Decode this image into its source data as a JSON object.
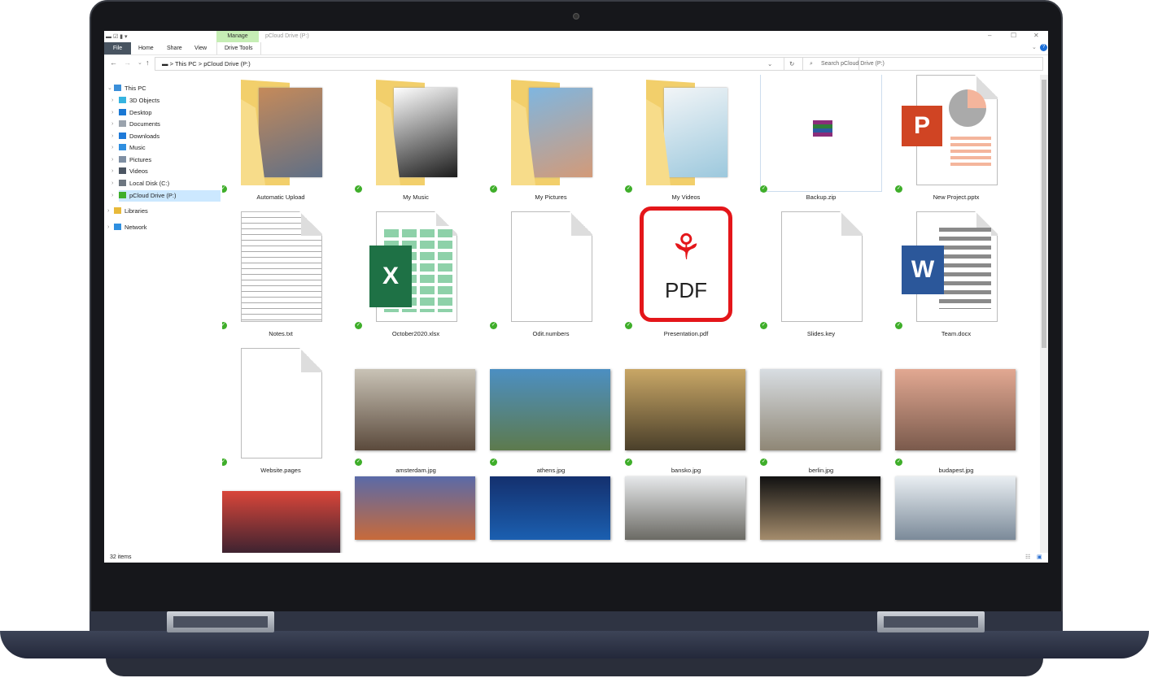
{
  "window": {
    "title": "pCloud Drive (P:)",
    "manage_tab": "Manage",
    "tabs": [
      "File",
      "Home",
      "Share",
      "View",
      "Drive Tools"
    ],
    "controls": {
      "minimize": "–",
      "maximize": "☐",
      "close": "✕"
    }
  },
  "address": {
    "parts": [
      "This PC",
      "pCloud Drive (P:)"
    ],
    "sep": ">",
    "search_placeholder": "Search pCloud Drive (P:)"
  },
  "nav": {
    "items": [
      {
        "label": "This PC",
        "indent": 0,
        "color": "#3b8fd9",
        "open": true
      },
      {
        "label": "3D Objects",
        "indent": 1,
        "color": "#36b4e0"
      },
      {
        "label": "Desktop",
        "indent": 1,
        "color": "#1a78d4"
      },
      {
        "label": "Documents",
        "indent": 1,
        "color": "#9aa3ad"
      },
      {
        "label": "Downloads",
        "indent": 1,
        "color": "#1f7ad8"
      },
      {
        "label": "Music",
        "indent": 1,
        "color": "#2f8fe0"
      },
      {
        "label": "Pictures",
        "indent": 1,
        "color": "#7f8fa3"
      },
      {
        "label": "Videos",
        "indent": 1,
        "color": "#4c5663"
      },
      {
        "label": "Local Disk (C:)",
        "indent": 1,
        "color": "#6d7680"
      },
      {
        "label": "pCloud Drive (P:)",
        "indent": 1,
        "color": "#3fae2a",
        "selected": true
      },
      {
        "label": "Libraries",
        "indent": 0,
        "color": "#e8b93a"
      },
      {
        "label": "Network",
        "indent": 0,
        "color": "#2e8fe0"
      }
    ]
  },
  "files": [
    {
      "name": "Automatic Upload",
      "kind": "folder",
      "colors": [
        "#c58a5a",
        "#5f6f86"
      ]
    },
    {
      "name": "My Music",
      "kind": "folder",
      "colors": [
        "#ffffff",
        "#1c1c1c"
      ]
    },
    {
      "name": "My Pictures",
      "kind": "folder",
      "colors": [
        "#7fb6e0",
        "#d39a78"
      ]
    },
    {
      "name": "My Videos",
      "kind": "folder",
      "colors": [
        "#f2f5f7",
        "#9cc8dd"
      ]
    },
    {
      "name": "Backup.zip",
      "kind": "zip",
      "colors": [
        "#8b2d7a",
        "#2f7d3a"
      ]
    },
    {
      "name": "New Project.pptx",
      "kind": "pptx",
      "colors": [
        "#d04423",
        "#f4b59c"
      ]
    },
    {
      "name": "Notes.txt",
      "kind": "txt",
      "colors": [
        "#ffffff",
        "#c8c8c8"
      ]
    },
    {
      "name": "October2020.xlsx",
      "kind": "xlsx",
      "colors": [
        "#1e7145",
        "#8ed1a9"
      ]
    },
    {
      "name": "Odit.numbers",
      "kind": "blank",
      "colors": [
        "#ffffff",
        "#dddddd"
      ]
    },
    {
      "name": "Presentation.pdf",
      "kind": "pdf",
      "colors": [
        "#e4161a",
        "#ffffff"
      ]
    },
    {
      "name": "Slides.key",
      "kind": "blank",
      "colors": [
        "#ffffff",
        "#dddddd"
      ]
    },
    {
      "name": "Team.docx",
      "kind": "docx",
      "colors": [
        "#2b579a",
        "#8a8a8a"
      ]
    },
    {
      "name": "Website.pages",
      "kind": "blank",
      "colors": [
        "#ffffff",
        "#dddddd"
      ]
    },
    {
      "name": "amsterdam.jpg",
      "kind": "photo",
      "colors": [
        "#c9c3b6",
        "#5b4a3c"
      ]
    },
    {
      "name": "athens.jpg",
      "kind": "photo",
      "colors": [
        "#4c8fc2",
        "#5d7a4d"
      ]
    },
    {
      "name": "bansko.jpg",
      "kind": "photo",
      "colors": [
        "#c9a766",
        "#4a3f2a"
      ]
    },
    {
      "name": "berlin.jpg",
      "kind": "photo",
      "colors": [
        "#d8dde2",
        "#8f8776"
      ]
    },
    {
      "name": "budapest.jpg",
      "kind": "photo",
      "colors": [
        "#e2a892",
        "#7a5a4c"
      ]
    },
    {
      "name": "",
      "kind": "photo",
      "colors": [
        "#d9463a",
        "#3a2230"
      ]
    },
    {
      "name": "",
      "kind": "photo",
      "colors": [
        "#5a6aa8",
        "#c86a3a"
      ]
    },
    {
      "name": "",
      "kind": "photo",
      "colors": [
        "#14306e",
        "#1b5fb0"
      ]
    },
    {
      "name": "",
      "kind": "photo",
      "colors": [
        "#e6e8ea",
        "#6b6a64"
      ]
    },
    {
      "name": "",
      "kind": "photo",
      "colors": [
        "#111111",
        "#a48c6c"
      ]
    },
    {
      "name": "",
      "kind": "photo",
      "colors": [
        "#e9eef2",
        "#7b8a99"
      ]
    }
  ],
  "status": {
    "count": "32 items"
  }
}
